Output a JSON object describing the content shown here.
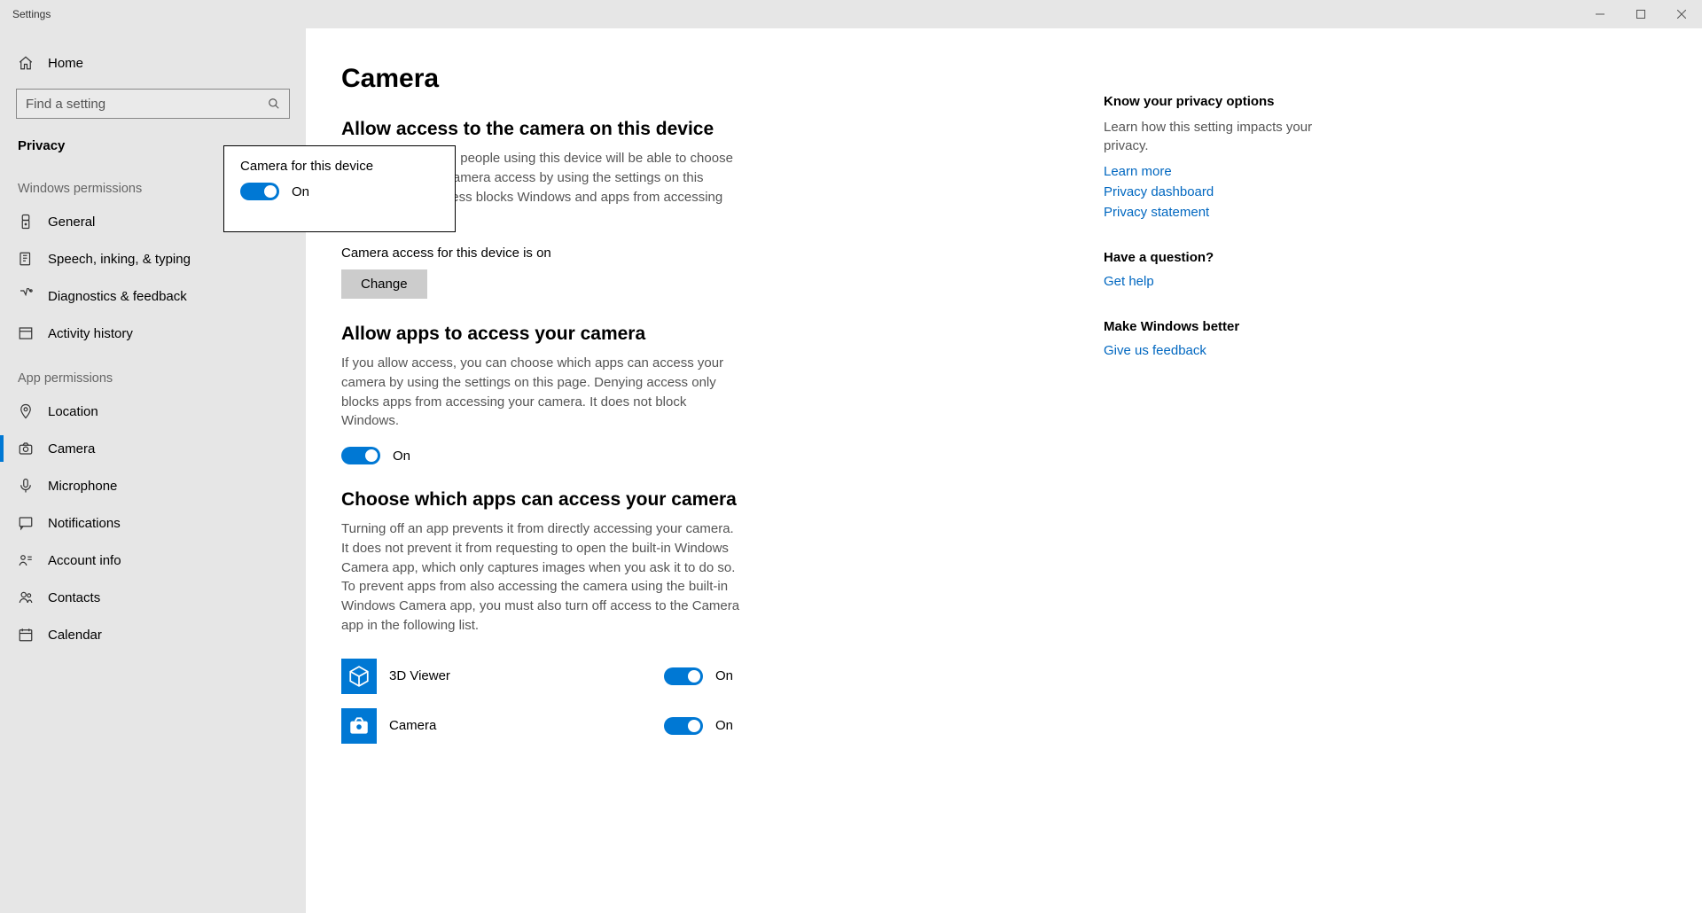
{
  "window": {
    "title": "Settings"
  },
  "sidebar": {
    "home": "Home",
    "search_placeholder": "Find a setting",
    "category": "Privacy",
    "groups": [
      {
        "title": "Windows permissions",
        "items": [
          {
            "key": "general",
            "label": "General"
          },
          {
            "key": "speech",
            "label": "Speech, inking, & typing"
          },
          {
            "key": "diagnostics",
            "label": "Diagnostics & feedback"
          },
          {
            "key": "activity",
            "label": "Activity history"
          }
        ]
      },
      {
        "title": "App permissions",
        "items": [
          {
            "key": "location",
            "label": "Location"
          },
          {
            "key": "camera",
            "label": "Camera",
            "active": true
          },
          {
            "key": "microphone",
            "label": "Microphone"
          },
          {
            "key": "notifications",
            "label": "Notifications"
          },
          {
            "key": "account-info",
            "label": "Account info"
          },
          {
            "key": "contacts",
            "label": "Contacts"
          },
          {
            "key": "calendar",
            "label": "Calendar"
          }
        ]
      }
    ]
  },
  "main": {
    "title": "Camera",
    "s1": {
      "title": "Allow access to the camera on this device",
      "desc": "If you allow access, people using this device will be able to choose if their apps have camera access by using the settings on this page. Denying access blocks Windows and apps from accessing the camera.",
      "status": "Camera access for this device is on",
      "change": "Change"
    },
    "s2": {
      "title": "Allow apps to access your camera",
      "desc": "If you allow access, you can choose which apps can access your camera by using the settings on this page. Denying access only blocks apps from accessing your camera. It does not block Windows.",
      "toggle_state": "On"
    },
    "s3": {
      "title": "Choose which apps can access your camera",
      "desc": "Turning off an app prevents it from directly accessing your camera. It does not prevent it from requesting to open the built-in Windows Camera app, which only captures images when you ask it to do so. To prevent apps from also accessing the camera using the built-in Windows Camera app, you must also turn off access to the Camera app in the following list.",
      "apps": [
        {
          "name": "3D Viewer",
          "state": "On",
          "icon": "cube"
        },
        {
          "name": "Camera",
          "state": "On",
          "icon": "camera"
        }
      ]
    }
  },
  "flyout": {
    "title": "Camera for this device",
    "state": "On"
  },
  "right": {
    "b1": {
      "head": "Know your privacy options",
      "text": "Learn how this setting impacts your privacy.",
      "links": [
        "Learn more",
        "Privacy dashboard",
        "Privacy statement"
      ]
    },
    "b2": {
      "head": "Have a question?",
      "links": [
        "Get help"
      ]
    },
    "b3": {
      "head": "Make Windows better",
      "links": [
        "Give us feedback"
      ]
    }
  }
}
